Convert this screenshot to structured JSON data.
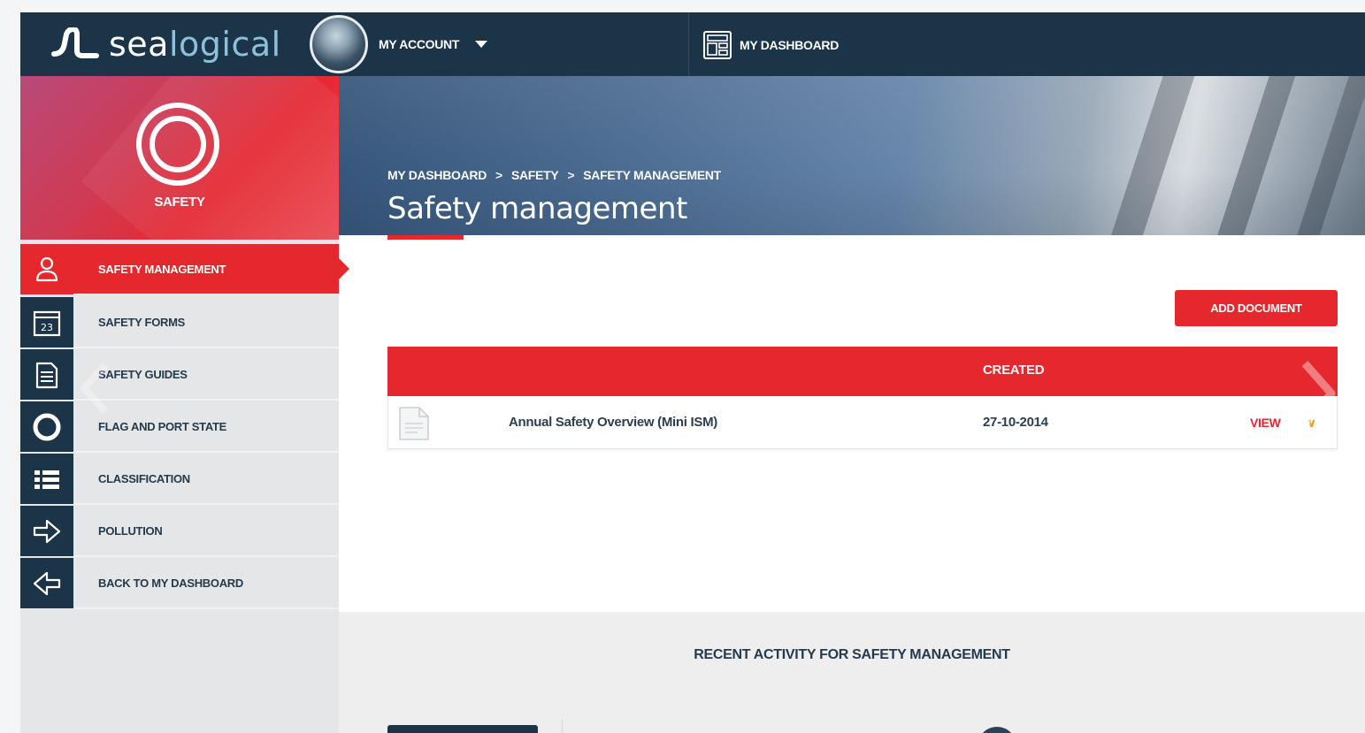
{
  "app": {
    "logo_left": "sea",
    "logo_right": "logical"
  },
  "topbar": {
    "account_label": "MY ACCOUNT",
    "dashboard_label": "MY DASHBOARD"
  },
  "sidebar": {
    "section_title": "SAFETY",
    "items": [
      {
        "label": "SAFETY MANAGEMENT",
        "icon": "person-icon",
        "active": true
      },
      {
        "label": "SAFETY FORMS",
        "icon": "calendar-icon",
        "active": false
      },
      {
        "label": "SAFETY GUIDES",
        "icon": "document-icon",
        "active": false
      },
      {
        "label": "FLAG AND PORT STATE",
        "icon": "ring-icon",
        "active": false
      },
      {
        "label": "CLASSIFICATION",
        "icon": "list-icon",
        "active": false
      },
      {
        "label": "POLLUTION",
        "icon": "arrow-right-icon",
        "active": false
      },
      {
        "label": "BACK TO MY DASHBOARD",
        "icon": "arrow-left-icon",
        "active": false
      }
    ]
  },
  "banner": {
    "breadcrumb": [
      "MY DASHBOARD",
      "SAFETY",
      "SAFETY MANAGEMENT"
    ],
    "breadcrumb_separator": ">",
    "title": "Safety management"
  },
  "main": {
    "add_button_label": "ADD DOCUMENT",
    "table": {
      "columns": [
        "",
        "",
        "CREATED",
        ""
      ],
      "rows": [
        {
          "title": "Annual Safety Overview (Mini ISM)",
          "created": "27-10-2014",
          "action": "VIEW"
        }
      ]
    }
  },
  "activity": {
    "title": "RECENT ACTIVITY FOR SAFETY MANAGEMENT"
  },
  "colors": {
    "navy": "#1b3448",
    "accent_red": "#e5282d",
    "chevron_orange": "#f0a020"
  }
}
